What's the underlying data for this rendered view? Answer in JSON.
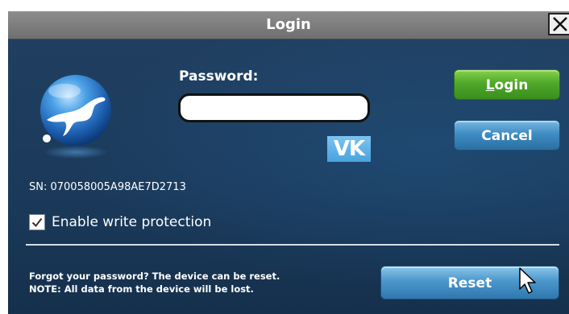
{
  "window": {
    "title": "Login",
    "close_icon": "close-icon"
  },
  "form": {
    "password_label": "Password:",
    "password_value": "",
    "password_placeholder": "",
    "keyboard_badge": "VK",
    "serial_number": "SN: 070058005A98AE7D2713",
    "write_protection_label": "Enable write protection",
    "write_protection_checked": true
  },
  "buttons": {
    "login_mnemonic": "L",
    "login_rest": "ogin",
    "cancel": "Cancel",
    "reset": "Reset"
  },
  "reset_note": {
    "line1": "Forgot your password? The device can be reset.",
    "line2": "NOTE: All data from the device will be lost."
  },
  "colors": {
    "panel_bg": "#1e3f63",
    "login_button": "#4fa82b",
    "blue_button": "#3f8cc3"
  }
}
